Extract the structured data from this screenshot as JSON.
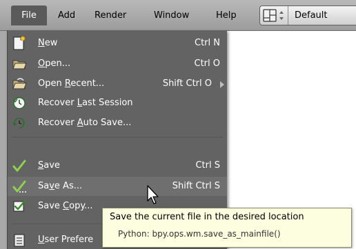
{
  "menubar": {
    "items": [
      {
        "label": "File"
      },
      {
        "label": "Add"
      },
      {
        "label": "Render"
      },
      {
        "label": "Window"
      },
      {
        "label": "Help"
      }
    ],
    "layout_selector": {
      "value": "Default",
      "icon": "screen-layout-icon"
    }
  },
  "file_menu": {
    "items": [
      {
        "pre": "",
        "key": "N",
        "post": "ew",
        "shortcut": "Ctrl N",
        "icon": "new-file-icon"
      },
      {
        "pre": "",
        "key": "O",
        "post": "pen...",
        "shortcut": "Ctrl O",
        "icon": "folder-open-icon"
      },
      {
        "pre": "Open ",
        "key": "R",
        "post": "ecent...",
        "shortcut": "Shift Ctrl O",
        "icon": "open-recent-icon",
        "submenu": true
      },
      {
        "pre": "Recover ",
        "key": "L",
        "post": "ast Session",
        "shortcut": "",
        "icon": "recover-icon"
      },
      {
        "pre": "Recover ",
        "key": "A",
        "post": "uto Save...",
        "shortcut": "",
        "icon": "recover-auto-icon"
      },
      {
        "pre": "",
        "key": "S",
        "post": "ave",
        "shortcut": "Ctrl S",
        "icon": "save-checkmark-icon"
      },
      {
        "pre": "Sa",
        "key": "v",
        "post": "e As...",
        "shortcut": "Shift Ctrl S",
        "icon": "save-as-icon",
        "active": true
      },
      {
        "pre": "Save ",
        "key": "C",
        "post": "opy...",
        "shortcut": "",
        "icon": "save-copy-icon"
      },
      {
        "pre": "",
        "key": "U",
        "post": "ser Prefere",
        "shortcut": "",
        "icon": "user-preferences-icon"
      }
    ]
  },
  "tooltip": {
    "description": "Save the current file in the desired location",
    "python": "Python: bpy.ops.wm.save_as_mainfile()"
  },
  "colors": {
    "menu_bg": "#636363",
    "menu_active": "#6f6f6f",
    "menu_text": "#ffffff",
    "tooltip_bg": "#fdfde0",
    "header_bg": "#a9a9a9"
  }
}
